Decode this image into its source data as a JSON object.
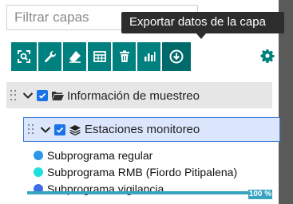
{
  "search": {
    "placeholder": "Filtrar capas"
  },
  "tooltip": {
    "text": "Exportar datos de la capa"
  },
  "toolbar": {
    "buttons": [
      {
        "icon": "zoom-to-extent-icon"
      },
      {
        "icon": "wrench-icon"
      },
      {
        "icon": "eraser-icon"
      },
      {
        "icon": "table-icon"
      },
      {
        "icon": "trash-icon"
      },
      {
        "icon": "bar-chart-icon"
      },
      {
        "icon": "export-circle-arrow-icon"
      }
    ],
    "settings_icon": "gear-icon"
  },
  "tree": {
    "group": {
      "label": "Información de muestreo",
      "checked": true,
      "expanded": true
    },
    "layer": {
      "label": "Estaciones monitoreo",
      "checked": true,
      "expanded": true
    },
    "legend": [
      {
        "label": "Subprograma regular",
        "color": "#2c97e8"
      },
      {
        "label": "Subprograma RMB (Fiordo Pitipalena)",
        "color": "#1fe0e0"
      },
      {
        "label": "Subprograma vigilancia",
        "color": "#3f6fe6"
      }
    ],
    "progress": {
      "value": 100,
      "text": "100 %"
    }
  },
  "colors": {
    "toolbar": "#00807f",
    "toolbar_active": "#006a6a",
    "accent": "#1a73e8",
    "selection": "#dbe5fb"
  }
}
